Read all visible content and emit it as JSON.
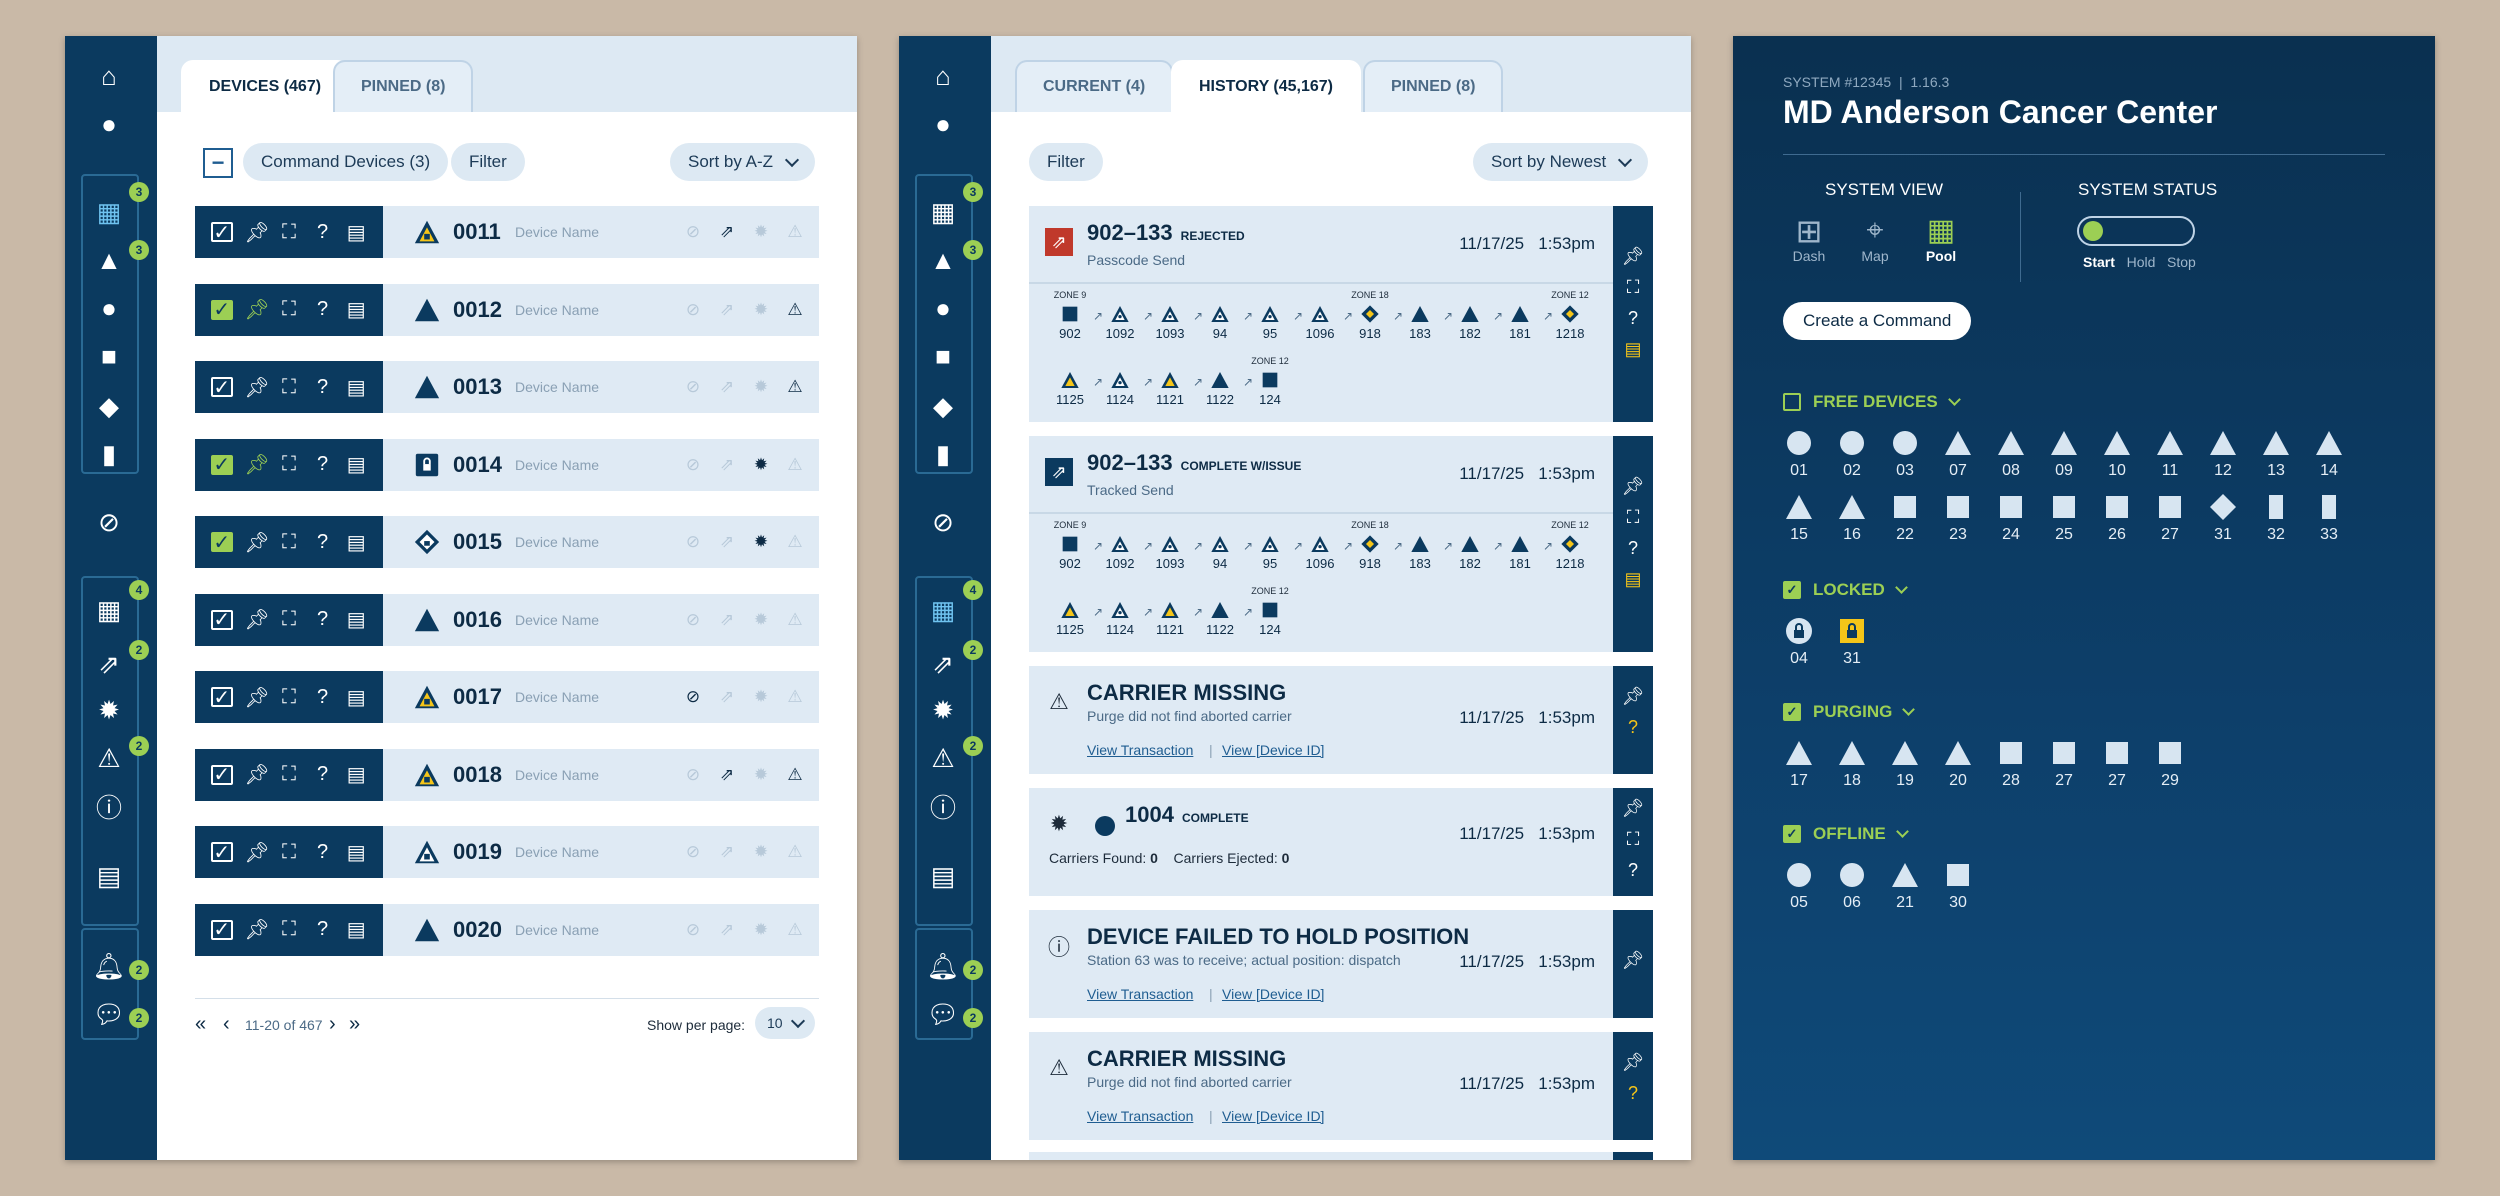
{
  "panel1": {
    "tabs": [
      "DEVICES (467)",
      "PINNED (8)"
    ],
    "command_devices": "Command Devices (3)",
    "filter": "Filter",
    "sort": "Sort by A-Z",
    "rows": [
      {
        "num": "0011",
        "name": "Device Name",
        "checked": false,
        "pinned": false,
        "shape": "triangle-lock-yellow"
      },
      {
        "num": "0012",
        "name": "Device Name",
        "checked": true,
        "pinned": true,
        "shape": "triangle"
      },
      {
        "num": "0013",
        "name": "Device Name",
        "checked": false,
        "pinned": false,
        "shape": "triangle"
      },
      {
        "num": "0014",
        "name": "Device Name",
        "checked": true,
        "pinned": true,
        "shape": "square-lock"
      },
      {
        "num": "0015",
        "name": "Device Name",
        "checked": true,
        "pinned": false,
        "shape": "diamond-lock"
      },
      {
        "num": "0016",
        "name": "Device Name",
        "checked": false,
        "pinned": false,
        "shape": "triangle"
      },
      {
        "num": "0017",
        "name": "Device Name",
        "checked": false,
        "pinned": false,
        "shape": "triangle-lock-yellow"
      },
      {
        "num": "0018",
        "name": "Device Name",
        "checked": false,
        "pinned": false,
        "shape": "triangle-lock-yellow"
      },
      {
        "num": "0019",
        "name": "Device Name",
        "checked": false,
        "pinned": false,
        "shape": "triangle-lock"
      },
      {
        "num": "0020",
        "name": "Device Name",
        "checked": false,
        "pinned": false,
        "shape": "triangle"
      }
    ],
    "pager_text": "11-20 of 467",
    "per_page_label": "Show per page:",
    "per_page_value": "10"
  },
  "panel2": {
    "tabs": [
      "CURRENT (4)",
      "HISTORY (45,167)",
      "PINNED (8)"
    ],
    "filter": "Filter",
    "sort": "Sort by Newest",
    "cards": [
      {
        "title": "902–133",
        "tag": "REJECTED",
        "sub": "Passcode Send",
        "date": "11/17/25",
        "time": "1:53pm"
      },
      {
        "title": "902–133",
        "tag": "COMPLETE W/ISSUE",
        "sub": "Tracked Send",
        "date": "11/17/25",
        "time": "1:53pm"
      },
      {
        "title": "CARRIER MISSING",
        "sub": "Purge did not find aborted carrier",
        "date": "11/17/25",
        "time": "1:53pm",
        "link1": "View Transaction",
        "link2": "View [Device ID]"
      },
      {
        "title": "1004",
        "tag": "COMPLETE",
        "found_label": "Carriers Found:",
        "found": "0",
        "ejected_label": "Carriers Ejected:",
        "ejected": "0",
        "date": "11/17/25",
        "time": "1:53pm"
      },
      {
        "title": "DEVICE FAILED TO HOLD POSITION",
        "sub": "Station 63 was to receive; actual position: dispatch",
        "date": "11/17/25",
        "time": "1:53pm",
        "link1": "View Transaction",
        "link2": "View [Device ID]"
      },
      {
        "title": "CARRIER MISSING",
        "sub": "Purge did not find aborted carrier",
        "date": "11/17/25",
        "time": "1:53pm",
        "link1": "View Transaction",
        "link2": "View [Device ID]"
      }
    ],
    "route_row1": [
      {
        "zone": "ZONE 9",
        "v": "902",
        "s": "square"
      },
      {
        "zone": "",
        "v": "1092",
        "s": "tri-o"
      },
      {
        "zone": "",
        "v": "1093",
        "s": "tri-o"
      },
      {
        "zone": "",
        "v": "94",
        "s": "tri-o"
      },
      {
        "zone": "",
        "v": "95",
        "s": "tri-o"
      },
      {
        "zone": "",
        "v": "1096",
        "s": "tri-o"
      },
      {
        "zone": "ZONE 18",
        "v": "918",
        "s": "dia-y"
      },
      {
        "zone": "",
        "v": "183",
        "s": "tri"
      },
      {
        "zone": "",
        "v": "182",
        "s": "tri"
      },
      {
        "zone": "",
        "v": "181",
        "s": "tri"
      },
      {
        "zone": "ZONE 12",
        "v": "1218",
        "s": "dia-y"
      }
    ],
    "route_row2": [
      {
        "zone": "",
        "v": "1125",
        "s": "tri-y"
      },
      {
        "zone": "",
        "v": "1124",
        "s": "tri-o"
      },
      {
        "zone": "",
        "v": "1121",
        "s": "tri-y"
      },
      {
        "zone": "",
        "v": "1122",
        "s": "tri"
      },
      {
        "zone": "ZONE 12",
        "v": "124",
        "s": "square"
      }
    ]
  },
  "panel3": {
    "system_id": "SYSTEM #12345",
    "version": "1.16.3",
    "title": "MD Anderson Cancer Center",
    "view_label": "SYSTEM VIEW",
    "views": [
      "Dash",
      "Map",
      "Pool"
    ],
    "status_label": "SYSTEM STATUS",
    "status_opts": [
      "Start",
      "Hold",
      "Stop"
    ],
    "create_btn": "Create a Command",
    "free_label": "FREE DEVICES",
    "free_row1": [
      {
        "v": "01",
        "s": "circle"
      },
      {
        "v": "02",
        "s": "circle"
      },
      {
        "v": "03",
        "s": "circle"
      },
      {
        "v": "07",
        "s": "tri"
      },
      {
        "v": "08",
        "s": "tri"
      },
      {
        "v": "09",
        "s": "tri"
      },
      {
        "v": "10",
        "s": "tri"
      },
      {
        "v": "11",
        "s": "tri"
      },
      {
        "v": "12",
        "s": "tri"
      },
      {
        "v": "13",
        "s": "tri"
      },
      {
        "v": "14",
        "s": "tri"
      }
    ],
    "free_row2": [
      {
        "v": "15",
        "s": "tri"
      },
      {
        "v": "16",
        "s": "tri"
      },
      {
        "v": "22",
        "s": "square"
      },
      {
        "v": "23",
        "s": "square"
      },
      {
        "v": "24",
        "s": "square"
      },
      {
        "v": "25",
        "s": "square"
      },
      {
        "v": "26",
        "s": "square"
      },
      {
        "v": "27",
        "s": "square"
      },
      {
        "v": "31",
        "s": "diamond"
      },
      {
        "v": "32",
        "s": "rect"
      },
      {
        "v": "33",
        "s": "rect"
      }
    ],
    "locked_label": "LOCKED",
    "locked": [
      {
        "v": "04",
        "s": "lock-circle"
      },
      {
        "v": "31",
        "s": "lock-yellow"
      }
    ],
    "purging_label": "PURGING",
    "purging": [
      {
        "v": "17",
        "s": "tri"
      },
      {
        "v": "18",
        "s": "tri"
      },
      {
        "v": "19",
        "s": "tri"
      },
      {
        "v": "20",
        "s": "tri"
      },
      {
        "v": "28",
        "s": "square"
      },
      {
        "v": "27",
        "s": "square"
      },
      {
        "v": "27",
        "s": "square"
      },
      {
        "v": "29",
        "s": "square"
      }
    ],
    "offline_label": "OFFLINE",
    "offline": [
      {
        "v": "05",
        "s": "circle"
      },
      {
        "v": "06",
        "s": "circle"
      },
      {
        "v": "21",
        "s": "tri"
      },
      {
        "v": "30",
        "s": "square"
      }
    ]
  },
  "rail": {
    "badges": [
      "3",
      "3",
      "4",
      "2",
      "2",
      "2",
      "2"
    ]
  },
  "colors": {
    "navy": "#0b3a5f",
    "green": "#9ccf54",
    "yellow": "#f5c518",
    "row": "#dfeaf4"
  }
}
